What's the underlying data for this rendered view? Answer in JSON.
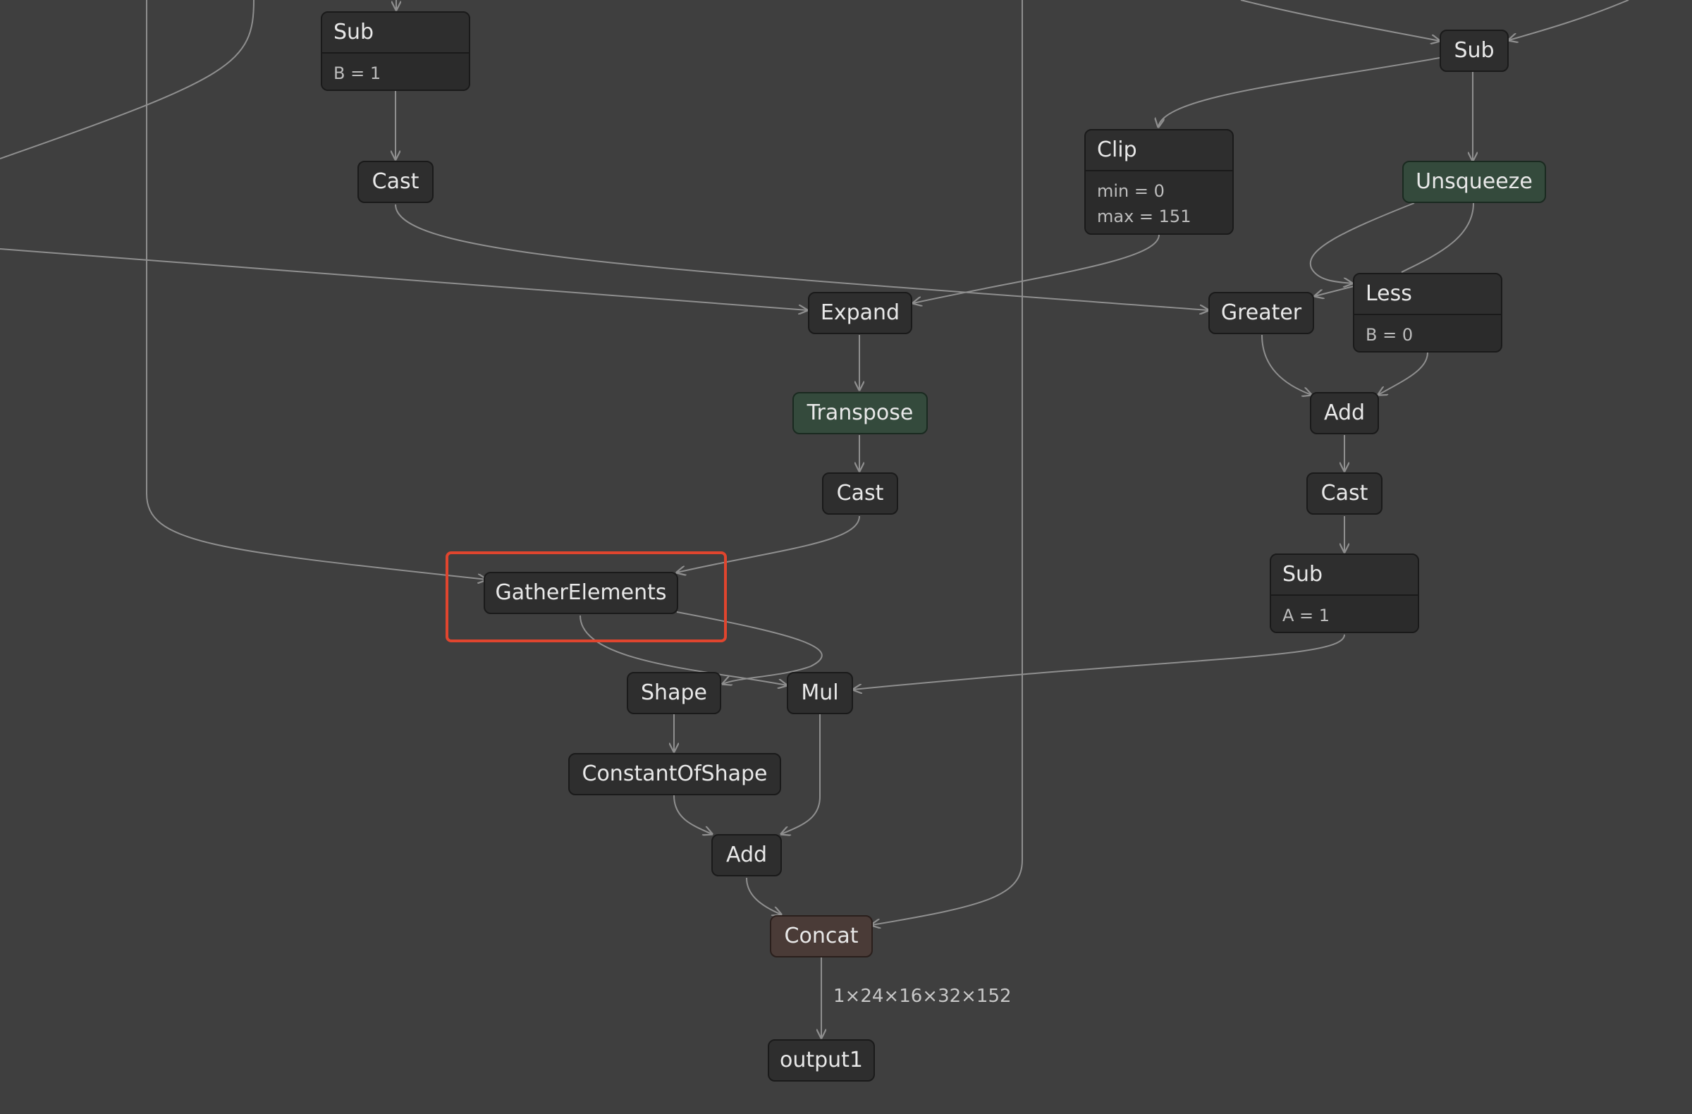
{
  "nodes": {
    "sub_top": {
      "title": "Sub",
      "attrs": [
        "B = 1"
      ]
    },
    "cast_top": {
      "title": "Cast"
    },
    "sub_right": {
      "title": "Sub"
    },
    "clip": {
      "title": "Clip",
      "attrs": [
        "min = 0",
        "max = 151"
      ]
    },
    "unsqueeze": {
      "title": "Unsqueeze"
    },
    "expand": {
      "title": "Expand"
    },
    "greater": {
      "title": "Greater"
    },
    "less": {
      "title": "Less",
      "attrs": [
        "B = 0"
      ]
    },
    "transpose": {
      "title": "Transpose"
    },
    "add_right": {
      "title": "Add"
    },
    "cast_mid": {
      "title": "Cast"
    },
    "cast_right": {
      "title": "Cast"
    },
    "gather": {
      "title": "GatherElements"
    },
    "sub_right2": {
      "title": "Sub",
      "attrs": [
        "A = 1"
      ]
    },
    "shape": {
      "title": "Shape"
    },
    "mul": {
      "title": "Mul"
    },
    "constantofshape": {
      "title": "ConstantOfShape"
    },
    "add_bottom": {
      "title": "Add"
    },
    "concat": {
      "title": "Concat"
    },
    "output": {
      "title": "output1"
    }
  },
  "edge_labels": {
    "concat_output": "1×24×16×32×152"
  },
  "colors": {
    "highlight": "#e0452e",
    "green_node": "#344a3c",
    "brown_node": "#4a3b37"
  }
}
